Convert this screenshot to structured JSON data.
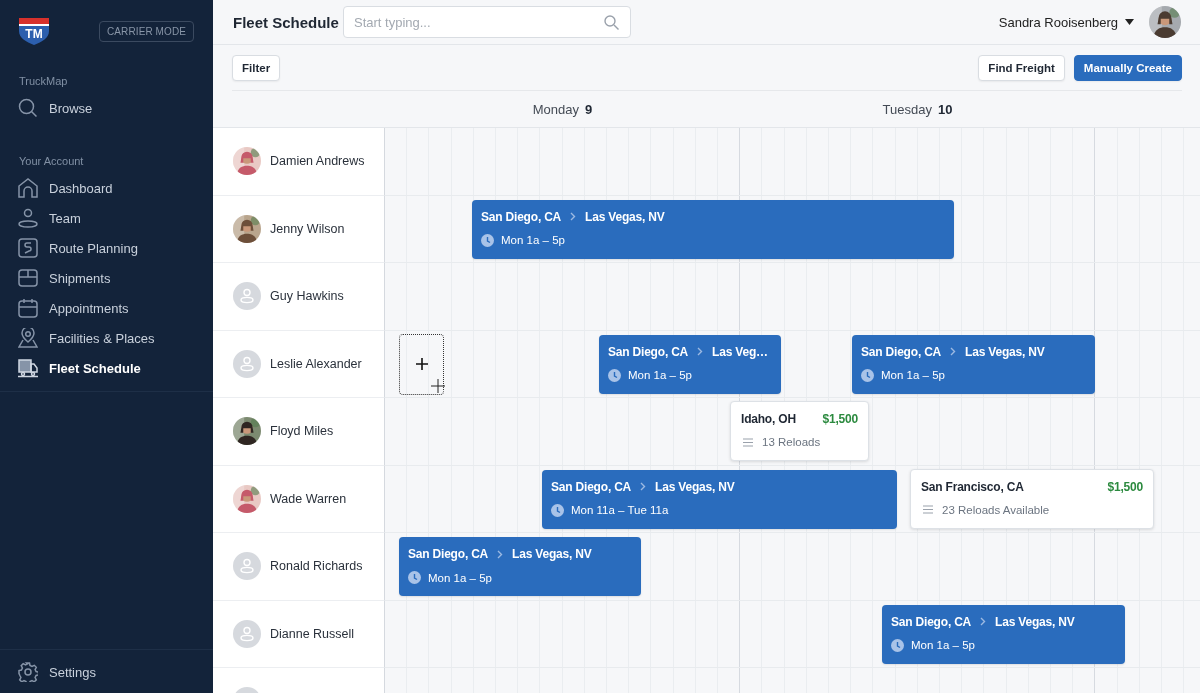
{
  "sidebar": {
    "logo_text": "TM",
    "mode_badge": "CARRIER MODE",
    "sections": [
      {
        "heading": "TruckMap",
        "items": [
          {
            "label": "Browse",
            "selected": false
          }
        ]
      },
      {
        "heading": "Your Account",
        "items": [
          {
            "label": "Dashboard",
            "selected": false
          },
          {
            "label": "Team",
            "selected": false
          },
          {
            "label": "Route Planning",
            "selected": false
          },
          {
            "label": "Shipments",
            "selected": false
          },
          {
            "label": "Appointments",
            "selected": false
          },
          {
            "label": "Facilities & Places",
            "selected": false
          },
          {
            "label": "Fleet Schedule",
            "selected": true
          }
        ]
      }
    ],
    "footer_item": {
      "label": "Settings"
    }
  },
  "header": {
    "title": "Fleet Schedule",
    "search": {
      "placeholder": "Start typing..."
    },
    "user_name": "Sandra Rooisenberg"
  },
  "toolbar": {
    "left_buttons": [
      "Filter"
    ],
    "right_buttons": [
      {
        "label": "Find Freight",
        "kind": "secondary"
      },
      {
        "label": "Manually Create",
        "kind": "primary"
      }
    ]
  },
  "days": [
    {
      "weekday": "Monday",
      "date": "9"
    },
    {
      "weekday": "Tuesday",
      "date": "10"
    }
  ],
  "drivers": [
    {
      "name": "Damien Andrews",
      "has_photo": true
    },
    {
      "name": "Jenny Wilson",
      "has_photo": true,
      "bookings": [
        {
          "kind": "trip",
          "origin": "San Diego, CA",
          "destination": "Las Vegas, NV",
          "time": "Mon 1a – 5p"
        }
      ]
    },
    {
      "name": "Guy Hawkins",
      "has_photo": false
    },
    {
      "name": "Leslie Alexander",
      "has_photo": false,
      "bookings": [
        {
          "kind": "add-slot"
        },
        {
          "kind": "trip",
          "origin": "San Diego, CA",
          "destination": "Las Veg…",
          "time": "Mon 1a – 5p"
        },
        {
          "kind": "trip",
          "origin": "San Diego, CA",
          "destination": "Las Vegas, NV",
          "time": "Mon 1a – 5p"
        }
      ]
    },
    {
      "name": "Floyd Miles",
      "has_photo": true,
      "bookings": [
        {
          "kind": "load",
          "place": "Idaho, OH",
          "price": "$1,500",
          "reloads": "13 Reloads"
        }
      ]
    },
    {
      "name": "Wade Warren",
      "has_photo": true,
      "bookings": [
        {
          "kind": "trip",
          "origin": "San Diego, CA",
          "destination": "Las Vegas, NV",
          "time": "Mon 11a – Tue 11a"
        },
        {
          "kind": "load",
          "place": "San Francisco, CA",
          "price": "$1,500",
          "reloads": "23 Reloads Available"
        }
      ]
    },
    {
      "name": "Ronald Richards",
      "has_photo": false,
      "bookings": [
        {
          "kind": "trip",
          "origin": "San Diego, CA",
          "destination": "Las Vegas, NV",
          "time": "Mon 1a – 5p"
        }
      ]
    },
    {
      "name": "Dianne Russell",
      "has_photo": false,
      "bookings": [
        {
          "kind": "trip",
          "origin": "San Diego, CA",
          "destination": "Las Vegas, NV",
          "time": "Mon 1a – 5p"
        }
      ]
    },
    {
      "has_photo": false
    }
  ]
}
